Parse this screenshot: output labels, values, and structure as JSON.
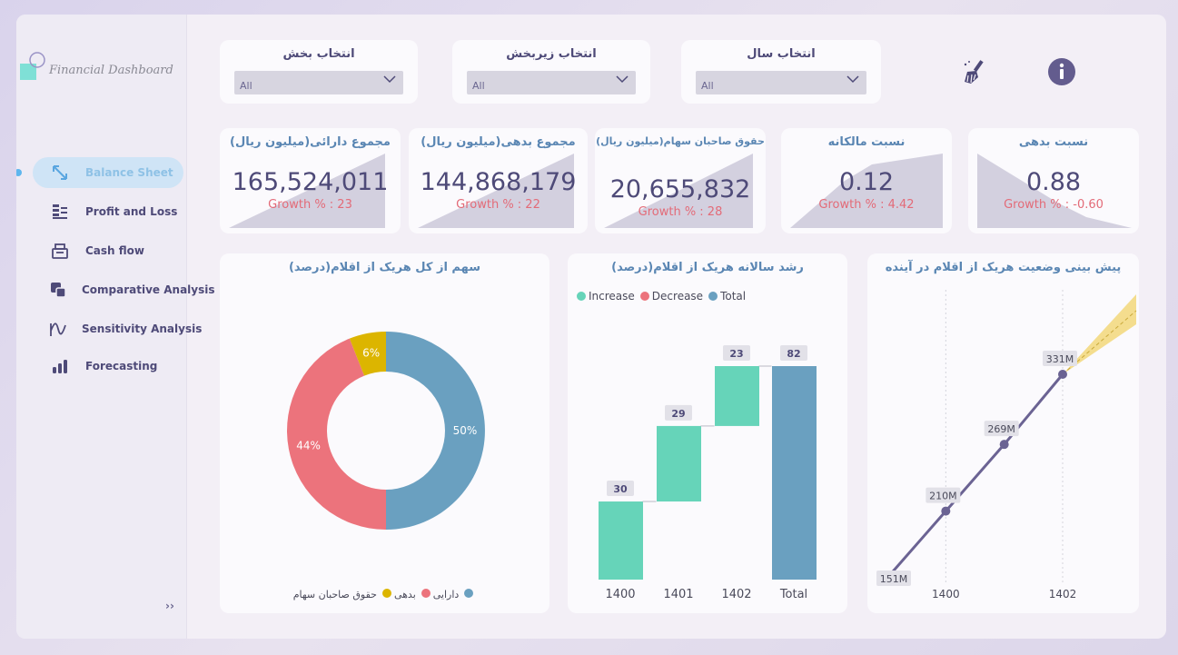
{
  "app": {
    "logo_text": "Financial Dashboard"
  },
  "sidebar": {
    "items": [
      {
        "label": "Balance Sheet",
        "icon": "swap-arrows-icon",
        "active": true
      },
      {
        "label": "Profit and Loss",
        "icon": "list-icon",
        "active": false
      },
      {
        "label": "Cash flow",
        "icon": "cash-register-icon",
        "active": false
      },
      {
        "label": "Comparative Analysis",
        "icon": "compare-squares-icon",
        "active": false
      },
      {
        "label": "Sensitivity Analysis",
        "icon": "sensitivity-wave-icon",
        "active": false
      },
      {
        "label": "Forecasting",
        "icon": "bar-chart-icon",
        "active": false
      }
    ],
    "expand_label": "››"
  },
  "filters": {
    "section": {
      "label": "انتخاب بخش",
      "value": "All"
    },
    "subsection": {
      "label": "انتخاب زیربخش",
      "value": "All"
    },
    "year": {
      "label": "انتخاب سال",
      "value": "All"
    }
  },
  "toolbar": {
    "clear_icon": "broom-icon",
    "info_icon": "info-icon"
  },
  "kpis": [
    {
      "title": "مجموع دارائی(میلیون ریال)",
      "value": "165,524,011",
      "growth": "Growth % : 23",
      "trend": "up"
    },
    {
      "title": "مجموع بدهی(میلیون ریال)",
      "value": "144,868,179",
      "growth": "Growth % : 22",
      "trend": "up"
    },
    {
      "title": "حقوق صاحبان سهام(میلیون ریال)",
      "value": "20,655,832",
      "growth": "Growth % : 28",
      "trend": "up"
    },
    {
      "title": "نسبت مالکانه",
      "value": "0.12",
      "growth": "Growth % : 4.42",
      "trend": "up"
    },
    {
      "title": "نسبت بدهی",
      "value": "0.88",
      "growth": "Growth % : -0.60",
      "trend": "down"
    }
  ],
  "colors": {
    "asset": "#6aa0c0",
    "debt": "#ec737c",
    "equity": "#dcb500",
    "increase": "#66d4b9",
    "decrease": "#ec737c",
    "total": "#6aa0c0",
    "line": "#6b6393",
    "accent": "#5a86b3"
  },
  "charts": {
    "donut": {
      "title": "سهم از کل هریک از اقلام(درصد)",
      "legend": [
        {
          "name": "دارایی",
          "color": "#6aa0c0"
        },
        {
          "name": "بدهی",
          "color": "#ec737c"
        },
        {
          "name": "حقوق صاحبان سهام",
          "color": "#dcb500"
        }
      ]
    },
    "waterfall": {
      "title": "رشد سالانه هریک از اقلام(درصد)",
      "legend": [
        {
          "name": "Increase",
          "color": "#66d4b9"
        },
        {
          "name": "Decrease",
          "color": "#ec737c"
        },
        {
          "name": "Total",
          "color": "#6aa0c0"
        }
      ]
    },
    "forecast": {
      "title": "پیش بینی وضعیت هریک از اقلام در آینده"
    }
  },
  "chart_data": [
    {
      "type": "pie",
      "title": "سهم از کل هریک از اقلام(درصد)",
      "donut": true,
      "slices": [
        {
          "name": "دارایی",
          "value": 50,
          "label": "50%"
        },
        {
          "name": "بدهی",
          "value": 44,
          "label": "44%"
        },
        {
          "name": "حقوق صاحبان سهام",
          "value": 6,
          "label": "6%"
        }
      ],
      "legend_position": "bottom"
    },
    {
      "type": "bar",
      "subtype": "waterfall",
      "title": "رشد سالانه هریک از اقلام(درصد)",
      "categories": [
        "1400",
        "1401",
        "1402",
        "Total"
      ],
      "values": [
        30,
        29,
        23,
        82
      ],
      "kinds": [
        "increase",
        "increase",
        "increase",
        "total"
      ],
      "legend_position": "top-left"
    },
    {
      "type": "line",
      "title": "پیش بینی وضعیت هریک از اقلام در آینده",
      "x": [
        1399,
        1400,
        1401,
        1402
      ],
      "y": [
        151,
        210,
        269,
        331
      ],
      "labels": [
        "151M",
        "210M",
        "269M",
        "331M"
      ],
      "x_ticks": [
        "1400",
        "1402"
      ],
      "forecast_band": true
    }
  ]
}
